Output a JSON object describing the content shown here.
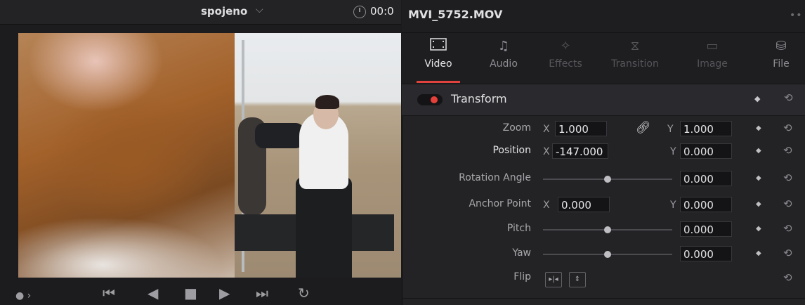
{
  "viewer": {
    "timeline_name": "spojeno",
    "timeline_chevron": "chevron-down-icon",
    "timecode": "00:0"
  },
  "inspector": {
    "clip_name": "MVI_5752.MOV",
    "tabs": [
      {
        "label": "Video",
        "icon": "film-icon",
        "state": "active"
      },
      {
        "label": "Audio",
        "icon": "music-note-icon",
        "state": "normal"
      },
      {
        "label": "Effects",
        "icon": "magic-wand-icon",
        "state": "disabled"
      },
      {
        "label": "Transition",
        "icon": "transition-icon",
        "state": "disabled"
      },
      {
        "label": "Image",
        "icon": "image-icon",
        "state": "disabled"
      },
      {
        "label": "File",
        "icon": "file-icon",
        "state": "normal"
      }
    ],
    "transform": {
      "title": "Transform",
      "zoom": {
        "label": "Zoom",
        "x_axis": "X",
        "x": "1.000",
        "y_axis": "Y",
        "y": "1.000"
      },
      "position": {
        "label": "Position",
        "x_axis": "X",
        "x": "-147.000",
        "y_axis": "Y",
        "y": "0.000"
      },
      "rotation": {
        "label": "Rotation Angle",
        "value": "0.000"
      },
      "anchor": {
        "label": "Anchor Point",
        "x_axis": "X",
        "x": "0.000",
        "y_axis": "Y",
        "y": "0.000"
      },
      "pitch": {
        "label": "Pitch",
        "value": "0.000"
      },
      "yaw": {
        "label": "Yaw",
        "value": "0.000"
      },
      "flip": {
        "label": "Flip"
      }
    }
  },
  "colors": {
    "accent": "#e0433d",
    "panel": "#232326",
    "field": "#141416"
  }
}
